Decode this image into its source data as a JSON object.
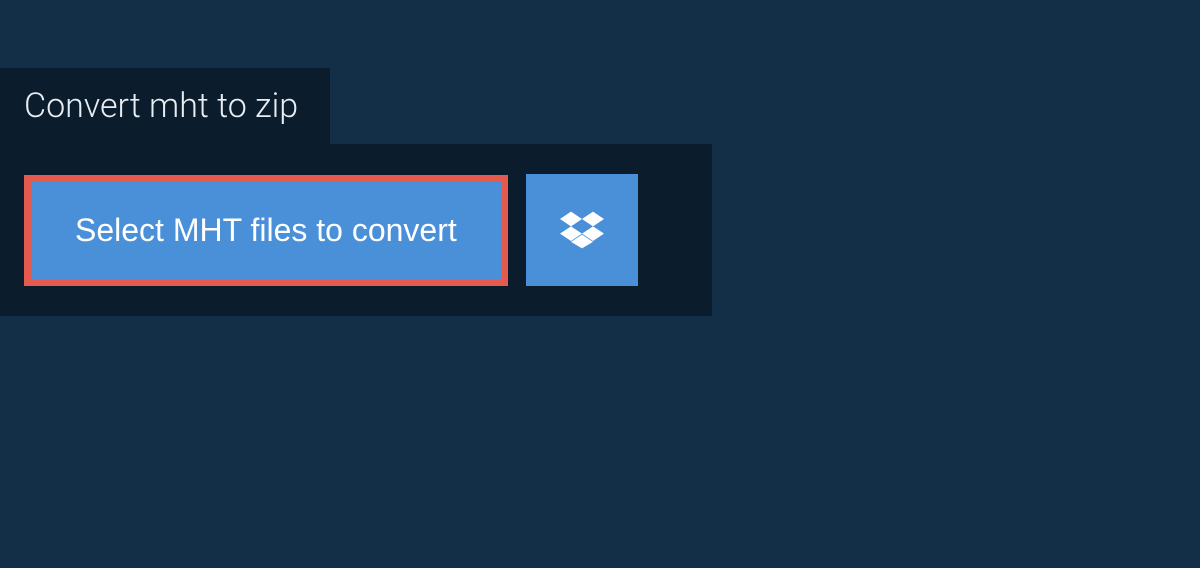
{
  "tab": {
    "title": "Convert mht to zip"
  },
  "upload": {
    "select_button_label": "Select MHT files to convert",
    "dropbox_icon": "dropbox-icon"
  },
  "colors": {
    "page_bg": "#132f48",
    "panel_bg": "#0b1c2c",
    "button_bg": "#4a90d9",
    "highlight_border": "#e55a4f",
    "text_light": "#e8edf2"
  }
}
